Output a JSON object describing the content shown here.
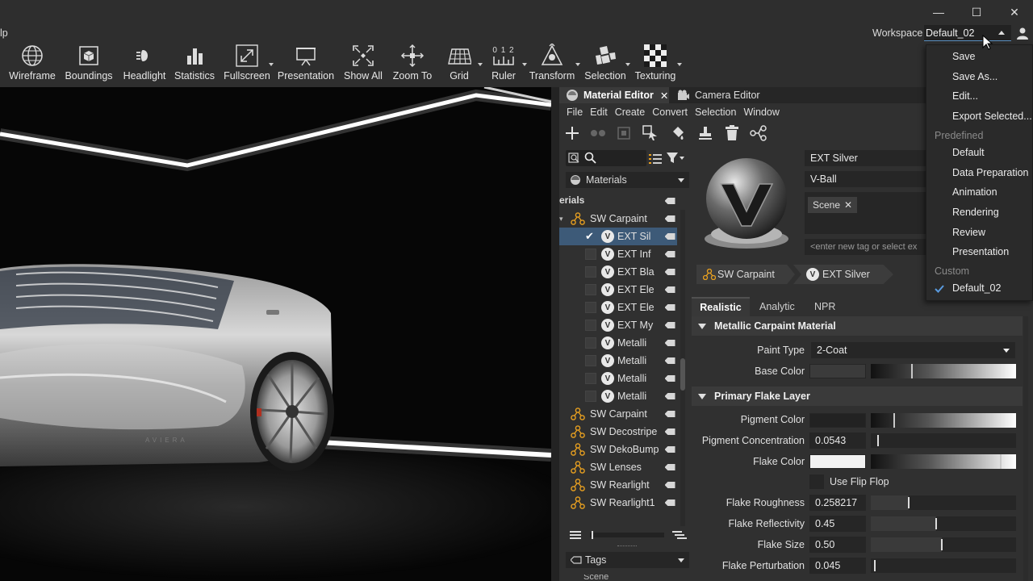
{
  "window": {
    "menu_fragment": "lp",
    "minimize": "—",
    "maximize": "☐",
    "close": "✕"
  },
  "toolbar": {
    "items": [
      {
        "label": "Wireframe",
        "icon": "globe-icon"
      },
      {
        "label": "Boundings",
        "icon": "cube-icon"
      },
      {
        "label": "Headlight",
        "icon": "headlight-icon"
      },
      {
        "label": "Statistics",
        "icon": "bar-chart-icon"
      },
      {
        "label": "Fullscreen",
        "icon": "fullscreen-icon"
      },
      {
        "label": "Presentation",
        "icon": "easel-icon"
      },
      {
        "label": "Show All",
        "icon": "show-all-icon"
      },
      {
        "label": "Zoom To",
        "icon": "zoom-to-icon"
      },
      {
        "label": "Grid",
        "icon": "grid-icon"
      },
      {
        "label": "Ruler",
        "icon": "ruler-icon"
      },
      {
        "label": "Transform",
        "icon": "transform-icon"
      },
      {
        "label": "Selection",
        "icon": "selection-icon"
      },
      {
        "label": "Texturing",
        "icon": "checker-icon"
      }
    ],
    "workspace_label": "Workspace",
    "workspace_value": "Default_02",
    "ruler_digits": "0 1 2"
  },
  "workspace_menu": {
    "items": [
      "Save",
      "Save As...",
      "Edit...",
      "Export Selected..."
    ],
    "predefined_label": "Predefined",
    "predefined": [
      "Default",
      "Data Preparation",
      "Animation",
      "Rendering",
      "Review",
      "Presentation"
    ],
    "custom_label": "Custom",
    "custom": [
      "Default_02"
    ],
    "checked": "Default_02"
  },
  "dock": {
    "tabs": [
      {
        "label": "Material Editor",
        "active": true
      },
      {
        "label": "Camera Editor",
        "active": false
      }
    ],
    "menu": [
      "File",
      "Edit",
      "Create",
      "Convert",
      "Selection",
      "Window"
    ],
    "filter_dropdown": "Materials",
    "tree_header": "erials",
    "tree": [
      {
        "type": "group",
        "label": "SW Carpaint",
        "expanded": true
      },
      {
        "type": "material",
        "label": "EXT Sil",
        "checked": true,
        "selected": true
      },
      {
        "type": "material",
        "label": "EXT Inf",
        "checked": false
      },
      {
        "type": "material",
        "label": "EXT Bla",
        "checked": false
      },
      {
        "type": "material",
        "label": "EXT Ele",
        "checked": false
      },
      {
        "type": "material",
        "label": "EXT Ele",
        "checked": false
      },
      {
        "type": "material",
        "label": "EXT My",
        "checked": false
      },
      {
        "type": "material",
        "label": "Metalli",
        "checked": false
      },
      {
        "type": "material",
        "label": "Metalli",
        "checked": false
      },
      {
        "type": "material",
        "label": "Metalli",
        "checked": false
      },
      {
        "type": "material",
        "label": "Metalli",
        "checked": false
      },
      {
        "type": "group",
        "label": "SW Carpaint"
      },
      {
        "type": "group",
        "label": "SW Decostripe"
      },
      {
        "type": "group",
        "label": "SW DekoBump"
      },
      {
        "type": "group",
        "label": "SW Lenses"
      },
      {
        "type": "group",
        "label": "SW Rearlight"
      },
      {
        "type": "group",
        "label": "SW Rearlight1"
      }
    ],
    "tags_dropdown": "Tags",
    "bottom_cut": "Scene"
  },
  "material": {
    "name": "EXT Silver",
    "preview_type": "V-Ball",
    "tag": "Scene",
    "tag_placeholder": "<enter new tag or select ex",
    "breadcrumb": [
      "SW Carpaint",
      "EXT Silver"
    ],
    "subtabs": [
      "Realistic",
      "Analytic",
      "NPR"
    ],
    "active_subtab": "Realistic",
    "section1": "Metallic Carpaint Material",
    "paint_type_label": "Paint Type",
    "paint_type_value": "2-Coat",
    "base_color_label": "Base Color",
    "section2": "Primary Flake Layer",
    "pigment_color_label": "Pigment Color",
    "pigment_conc_label": "Pigment Concentration",
    "pigment_conc_value": "0.0543",
    "flake_color_label": "Flake Color",
    "flip_flop_label": "Use Flip Flop",
    "flake_roughness_label": "Flake Roughness",
    "flake_roughness_value": "0.258217",
    "flake_reflectivity_label": "Flake Reflectivity",
    "flake_reflectivity_value": "0.45",
    "flake_size_label": "Flake Size",
    "flake_size_value": "0.50",
    "flake_perturbation_label": "Flake Perturbation",
    "flake_perturbation_value": "0.045"
  },
  "viewport": {
    "car_badge": "AVIERA"
  }
}
